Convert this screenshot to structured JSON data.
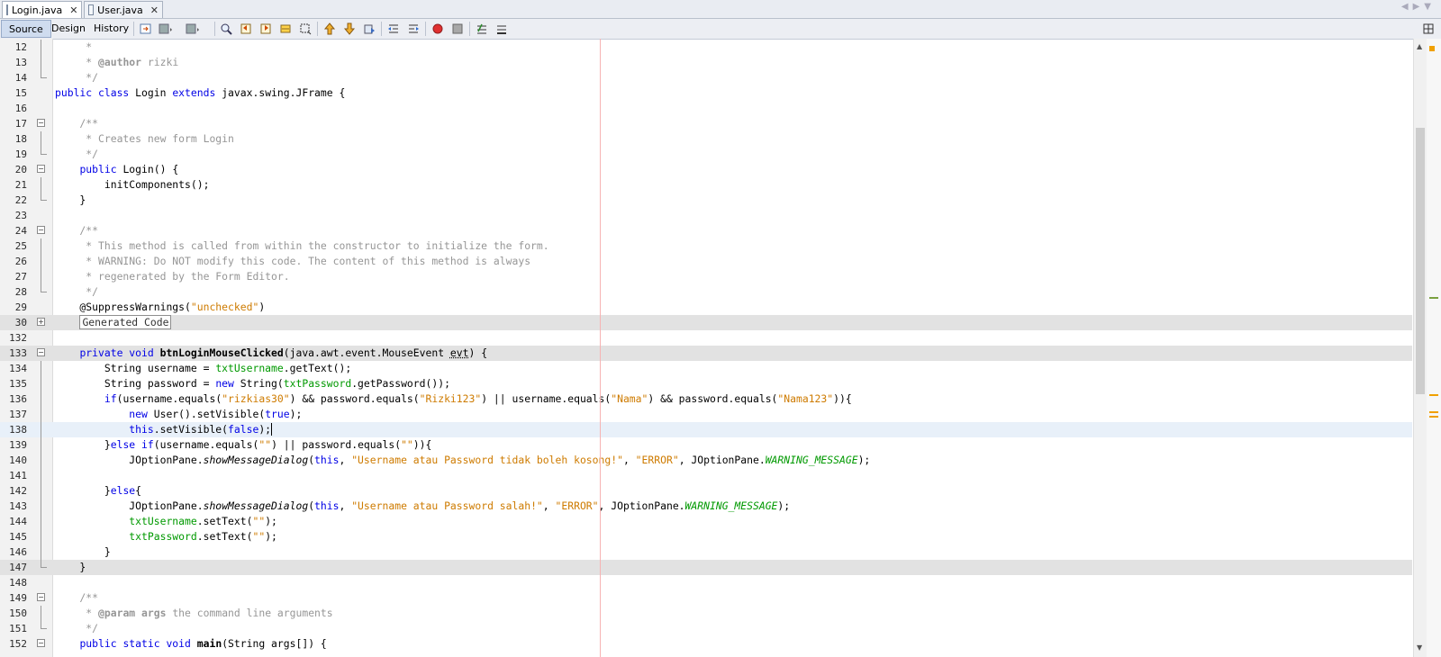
{
  "tabs": [
    {
      "label": "Login.java",
      "close": "✕",
      "active": true
    },
    {
      "label": "User.java",
      "close": "✕",
      "active": false
    }
  ],
  "toolbar": {
    "view_tabs": [
      "Source",
      "Design",
      "History"
    ]
  },
  "colors": {
    "keyword": "#0000e6",
    "string": "#ce7b00",
    "comment": "#969696",
    "field": "#009900",
    "margin_line": "#f6b3b3",
    "highlight_line": "#e2e2e2",
    "current_line": "#e8f0f9"
  },
  "editor": {
    "lines": [
      {
        "num": "12",
        "fold": "line",
        "tokens": [
          {
            "t": "cmt",
            "v": "     *"
          }
        ]
      },
      {
        "num": "13",
        "fold": "line",
        "tokens": [
          {
            "t": "cmt",
            "v": "     * "
          },
          {
            "t": "javadoctag",
            "v": "@author"
          },
          {
            "t": "cmt",
            "v": " rizki"
          }
        ]
      },
      {
        "num": "14",
        "fold": "end",
        "tokens": [
          {
            "t": "cmt",
            "v": "     */"
          }
        ]
      },
      {
        "num": "15",
        "fold": "",
        "tokens": [
          {
            "t": "kw",
            "v": "public class"
          },
          {
            "t": "plain",
            "v": " Login "
          },
          {
            "t": "kw",
            "v": "extends"
          },
          {
            "t": "plain",
            "v": " javax.swing.JFrame {"
          }
        ]
      },
      {
        "num": "16",
        "fold": "",
        "tokens": []
      },
      {
        "num": "17",
        "fold": "minus",
        "tokens": [
          {
            "t": "cmt",
            "v": "    /**"
          }
        ]
      },
      {
        "num": "18",
        "fold": "line",
        "tokens": [
          {
            "t": "cmt",
            "v": "     * Creates new form Login"
          }
        ]
      },
      {
        "num": "19",
        "fold": "end",
        "tokens": [
          {
            "t": "cmt",
            "v": "     */"
          }
        ]
      },
      {
        "num": "20",
        "fold": "minus",
        "tokens": [
          {
            "t": "plain",
            "v": "    "
          },
          {
            "t": "kw",
            "v": "public"
          },
          {
            "t": "plain",
            "v": " Login() {"
          }
        ]
      },
      {
        "num": "21",
        "fold": "line",
        "tokens": [
          {
            "t": "plain",
            "v": "        initComponents();"
          }
        ]
      },
      {
        "num": "22",
        "fold": "end",
        "tokens": [
          {
            "t": "plain",
            "v": "    }"
          }
        ]
      },
      {
        "num": "23",
        "fold": "",
        "tokens": []
      },
      {
        "num": "24",
        "fold": "minus",
        "tokens": [
          {
            "t": "cmt",
            "v": "    /**"
          }
        ]
      },
      {
        "num": "25",
        "fold": "line",
        "tokens": [
          {
            "t": "cmt",
            "v": "     * This method is called from within the constructor to initialize the form."
          }
        ]
      },
      {
        "num": "26",
        "fold": "line",
        "tokens": [
          {
            "t": "cmt",
            "v": "     * WARNING: Do NOT modify this code. The content of this method is always"
          }
        ]
      },
      {
        "num": "27",
        "fold": "line",
        "tokens": [
          {
            "t": "cmt",
            "v": "     * regenerated by the Form Editor."
          }
        ]
      },
      {
        "num": "28",
        "fold": "end",
        "tokens": [
          {
            "t": "cmt",
            "v": "     */"
          }
        ]
      },
      {
        "num": "29",
        "fold": "",
        "tokens": [
          {
            "t": "plain",
            "v": "    @SuppressWarnings("
          },
          {
            "t": "str",
            "v": "\"unchecked\""
          },
          {
            "t": "plain",
            "v": ")"
          }
        ]
      },
      {
        "num": "30",
        "fold": "plus",
        "hl": true,
        "tokens": [
          {
            "t": "plain",
            "v": "    "
          },
          {
            "t": "box",
            "v": "Generated Code"
          }
        ]
      },
      {
        "num": "132",
        "fold": "",
        "tokens": []
      },
      {
        "num": "133",
        "fold": "minus",
        "hl": true,
        "tokens": [
          {
            "t": "plain",
            "v": "    "
          },
          {
            "t": "kw",
            "v": "private void"
          },
          {
            "t": "plain",
            "v": " "
          },
          {
            "t": "bold",
            "v": "btnLoginMouseClicked"
          },
          {
            "t": "plain",
            "v": "(java.awt.event.MouseEvent "
          },
          {
            "t": "underline",
            "v": "evt"
          },
          {
            "t": "plain",
            "v": ") {"
          }
        ]
      },
      {
        "num": "134",
        "fold": "line",
        "tokens": [
          {
            "t": "plain",
            "v": "        String username = "
          },
          {
            "t": "field",
            "v": "txtUsername"
          },
          {
            "t": "plain",
            "v": ".getText();"
          }
        ]
      },
      {
        "num": "135",
        "fold": "line",
        "tokens": [
          {
            "t": "plain",
            "v": "        String password = "
          },
          {
            "t": "kw",
            "v": "new"
          },
          {
            "t": "plain",
            "v": " String("
          },
          {
            "t": "field",
            "v": "txtPassword"
          },
          {
            "t": "plain",
            "v": ".getPassword());"
          }
        ]
      },
      {
        "num": "136",
        "fold": "line",
        "tokens": [
          {
            "t": "plain",
            "v": "        "
          },
          {
            "t": "kw",
            "v": "if"
          },
          {
            "t": "plain",
            "v": "(username.equals("
          },
          {
            "t": "str",
            "v": "\"rizkias30\""
          },
          {
            "t": "plain",
            "v": ") && password.equals("
          },
          {
            "t": "str",
            "v": "\"Rizki123\""
          },
          {
            "t": "plain",
            "v": ") || username.equals("
          },
          {
            "t": "str",
            "v": "\"Nama\""
          },
          {
            "t": "plain",
            "v": ") && password.equals("
          },
          {
            "t": "str",
            "v": "\"Nama123\""
          },
          {
            "t": "plain",
            "v": ")){"
          }
        ]
      },
      {
        "num": "137",
        "fold": "line",
        "tokens": [
          {
            "t": "plain",
            "v": "            "
          },
          {
            "t": "kw",
            "v": "new"
          },
          {
            "t": "plain",
            "v": " User().setVisible("
          },
          {
            "t": "kw",
            "v": "true"
          },
          {
            "t": "plain",
            "v": ");"
          }
        ]
      },
      {
        "num": "138",
        "fold": "line",
        "cur": true,
        "tokens": [
          {
            "t": "plain",
            "v": "            "
          },
          {
            "t": "kw",
            "v": "this"
          },
          {
            "t": "plain",
            "v": ".setVisible("
          },
          {
            "t": "kw",
            "v": "false"
          },
          {
            "t": "caret",
            "v": ");"
          }
        ]
      },
      {
        "num": "139",
        "fold": "line",
        "tokens": [
          {
            "t": "plain",
            "v": "        }"
          },
          {
            "t": "kw",
            "v": "else if"
          },
          {
            "t": "plain",
            "v": "(username.equals("
          },
          {
            "t": "str",
            "v": "\"\""
          },
          {
            "t": "plain",
            "v": ") || password.equals("
          },
          {
            "t": "str",
            "v": "\"\""
          },
          {
            "t": "plain",
            "v": ")){"
          }
        ]
      },
      {
        "num": "140",
        "fold": "line",
        "tokens": [
          {
            "t": "plain",
            "v": "            JOptionPane."
          },
          {
            "t": "italic",
            "v": "showMessageDialog"
          },
          {
            "t": "plain",
            "v": "("
          },
          {
            "t": "kw",
            "v": "this"
          },
          {
            "t": "plain",
            "v": ", "
          },
          {
            "t": "str",
            "v": "\"Username atau Password tidak boleh kosong!\""
          },
          {
            "t": "plain",
            "v": ", "
          },
          {
            "t": "str",
            "v": "\"ERROR\""
          },
          {
            "t": "plain",
            "v": ", JOptionPane."
          },
          {
            "t": "fielditalic",
            "v": "WARNING_MESSAGE"
          },
          {
            "t": "plain",
            "v": ");"
          }
        ]
      },
      {
        "num": "141",
        "fold": "line",
        "tokens": []
      },
      {
        "num": "142",
        "fold": "line",
        "tokens": [
          {
            "t": "plain",
            "v": "        }"
          },
          {
            "t": "kw",
            "v": "else"
          },
          {
            "t": "plain",
            "v": "{"
          }
        ]
      },
      {
        "num": "143",
        "fold": "line",
        "tokens": [
          {
            "t": "plain",
            "v": "            JOptionPane."
          },
          {
            "t": "italic",
            "v": "showMessageDialog"
          },
          {
            "t": "plain",
            "v": "("
          },
          {
            "t": "kw",
            "v": "this"
          },
          {
            "t": "plain",
            "v": ", "
          },
          {
            "t": "str",
            "v": "\"Username atau Password salah!\""
          },
          {
            "t": "plain",
            "v": ", "
          },
          {
            "t": "str",
            "v": "\"ERROR\""
          },
          {
            "t": "plain",
            "v": ", JOptionPane."
          },
          {
            "t": "fielditalic",
            "v": "WARNING_MESSAGE"
          },
          {
            "t": "plain",
            "v": ");"
          }
        ]
      },
      {
        "num": "144",
        "fold": "line",
        "tokens": [
          {
            "t": "plain",
            "v": "            "
          },
          {
            "t": "field",
            "v": "txtUsername"
          },
          {
            "t": "plain",
            "v": ".setText("
          },
          {
            "t": "str",
            "v": "\"\""
          },
          {
            "t": "plain",
            "v": ");"
          }
        ]
      },
      {
        "num": "145",
        "fold": "line",
        "tokens": [
          {
            "t": "plain",
            "v": "            "
          },
          {
            "t": "field",
            "v": "txtPassword"
          },
          {
            "t": "plain",
            "v": ".setText("
          },
          {
            "t": "str",
            "v": "\"\""
          },
          {
            "t": "plain",
            "v": ");"
          }
        ]
      },
      {
        "num": "146",
        "fold": "line",
        "tokens": [
          {
            "t": "plain",
            "v": "        }"
          }
        ]
      },
      {
        "num": "147",
        "fold": "end",
        "hl": true,
        "tokens": [
          {
            "t": "plain",
            "v": "    }"
          }
        ]
      },
      {
        "num": "148",
        "fold": "",
        "tokens": []
      },
      {
        "num": "149",
        "fold": "minus",
        "tokens": [
          {
            "t": "cmt",
            "v": "    /**"
          }
        ]
      },
      {
        "num": "150",
        "fold": "line",
        "tokens": [
          {
            "t": "cmt",
            "v": "     * "
          },
          {
            "t": "javadoctag",
            "v": "@param"
          },
          {
            "t": "cmt",
            "v": " "
          },
          {
            "t": "javadoctag",
            "v": "args"
          },
          {
            "t": "cmt",
            "v": " the command line arguments"
          }
        ]
      },
      {
        "num": "151",
        "fold": "end",
        "tokens": [
          {
            "t": "cmt",
            "v": "     */"
          }
        ]
      },
      {
        "num": "152",
        "fold": "minus",
        "tokens": [
          {
            "t": "plain",
            "v": "    "
          },
          {
            "t": "kw",
            "v": "public static void"
          },
          {
            "t": "plain",
            "v": " "
          },
          {
            "t": "bold",
            "v": "main"
          },
          {
            "t": "plain",
            "v": "(String args[]) {"
          }
        ]
      }
    ]
  }
}
